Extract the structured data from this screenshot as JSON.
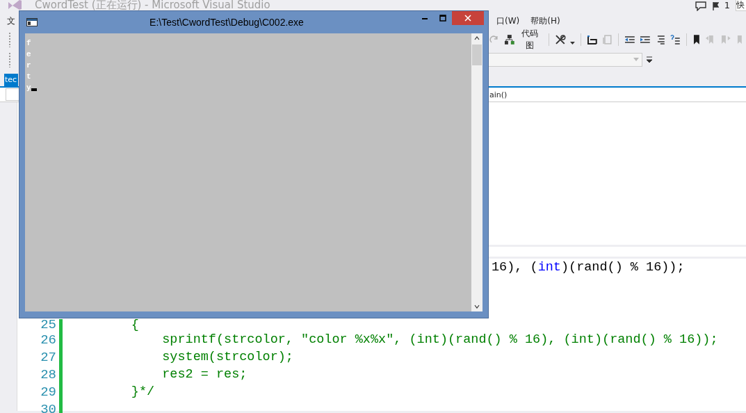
{
  "ide": {
    "title": "CwordTest (正在运行) - Microsoft Visual Studio",
    "notification_count": "1",
    "quick_launch": "快",
    "menu": [
      "文",
      "口(W)",
      "帮助(H)"
    ],
    "code_map_label": "代码图",
    "document_tab": {
      "label": "tec",
      "selected": true
    },
    "navigation": "ain()",
    "code_lines": [
      {
        "kind": "clipped",
        "segments": [
          {
            "text": "16), ",
            "kind": "plain"
          },
          {
            "text": "(",
            "kind": "plain"
          },
          {
            "text": "int",
            "kind": "keyword"
          },
          {
            "text": ")(rand() % 16));",
            "kind": "plain"
          }
        ]
      },
      {
        "number": "25",
        "kind": "code",
        "segments": [
          {
            "text": "        {",
            "kind": "comment"
          }
        ]
      },
      {
        "number": "26",
        "kind": "code",
        "segments": [
          {
            "text": "            sprintf(strcolor, \"color %x%x\", (int)(rand() % 16), (int)(rand() % 16));",
            "kind": "comment"
          }
        ]
      },
      {
        "number": "27",
        "kind": "code",
        "segments": [
          {
            "text": "            system(strcolor);",
            "kind": "comment"
          }
        ]
      },
      {
        "number": "28",
        "kind": "code",
        "segments": [
          {
            "text": "            res2 = res;",
            "kind": "comment"
          }
        ]
      },
      {
        "number": "29",
        "kind": "code",
        "segments": [
          {
            "text": "        }*/",
            "kind": "comment"
          }
        ]
      },
      {
        "number": "30",
        "kind": "code"
      }
    ]
  },
  "console": {
    "title": "E:\\Test\\CwordTest\\Debug\\C002.exe",
    "output": [
      "f",
      "e",
      "r",
      "t",
      "y"
    ]
  }
}
